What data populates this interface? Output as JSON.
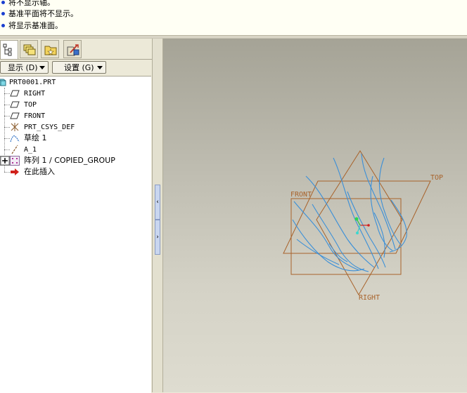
{
  "messages": [
    "将不显示轴。",
    "基准平面将不显示。",
    "将显示基准面。"
  ],
  "tabs": [
    {
      "icon": "model-tree-icon",
      "active": true
    },
    {
      "icon": "layers-icon",
      "active": false
    },
    {
      "icon": "favorites-folder-icon",
      "active": false
    },
    {
      "icon": "connections-icon",
      "active": false
    }
  ],
  "toolbar": {
    "show_label": "显示 (D)",
    "settings_label": "设置 (G)"
  },
  "tree": {
    "root": "PRT0001.PRT",
    "items": [
      {
        "label": "RIGHT",
        "icon": "datum-plane-icon"
      },
      {
        "label": "TOP",
        "icon": "datum-plane-icon"
      },
      {
        "label": "FRONT",
        "icon": "datum-plane-icon"
      },
      {
        "label": "PRT_CSYS_DEF",
        "icon": "coordinate-system-icon"
      },
      {
        "label": "草绘 1",
        "icon": "sketch-icon"
      },
      {
        "label": "A_1",
        "icon": "datum-axis-icon"
      },
      {
        "label": "阵列 1 / COPIED_GROUP",
        "icon": "pattern-icon"
      },
      {
        "label": "在此插入",
        "icon": "insert-here-arrow-icon"
      }
    ]
  },
  "viewport": {
    "plane_labels": {
      "front": "FRONT",
      "top": "TOP",
      "right": "RIGHT"
    },
    "colors": {
      "plane": "#a8622a",
      "curves": "#3a8fd8"
    }
  }
}
